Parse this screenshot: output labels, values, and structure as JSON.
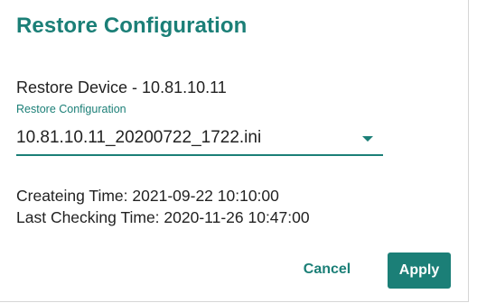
{
  "dialog": {
    "title": "Restore Configuration",
    "device_line": "Restore Device - 10.81.10.11",
    "select": {
      "label": "Restore Configuration",
      "value": "10.81.10.11_20200722_1722.ini",
      "icon": "dropdown-arrow-icon"
    },
    "info": {
      "creating_time": "Createing Time: 2021-09-22 10:10:00",
      "last_checking_time": "Last Checking Time: 2020-11-26 10:47:00"
    },
    "buttons": {
      "cancel_label": "Cancel",
      "apply_label": "Apply"
    },
    "colors": {
      "accent": "#1b7f77",
      "text": "#222222",
      "background": "#ffffff"
    }
  }
}
